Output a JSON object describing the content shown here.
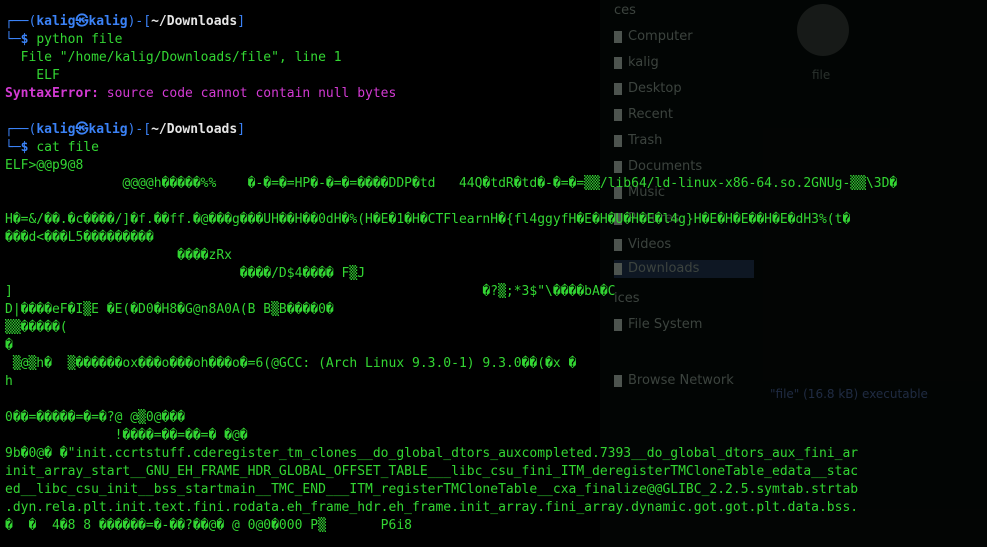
{
  "background_window": {
    "section_places": "ces",
    "sidebar": [
      {
        "label": "Computer"
      },
      {
        "label": "kalig"
      },
      {
        "label": "Desktop"
      },
      {
        "label": "Recent"
      },
      {
        "label": "Trash"
      },
      {
        "label": "Documents"
      },
      {
        "label": "Music"
      },
      {
        "label": "Pictures"
      },
      {
        "label": "Videos"
      },
      {
        "label": "Downloads"
      }
    ],
    "section_devices": "ices",
    "devices": [
      {
        "label": "File System"
      }
    ],
    "section_network": "",
    "network": [
      {
        "label": "Browse Network"
      }
    ],
    "file_icon_label": "file",
    "status_text": "\"file\" (16.8 kB) executable"
  },
  "terminal": {
    "prompt1": {
      "user": "kalig",
      "host": "kalig",
      "path": "~/Downloads",
      "command": "python file"
    },
    "python_error": {
      "file_line": "  File \"/home/kalig/Downloads/file\", line 1",
      "elf_line": "    ELF",
      "error_type": "SyntaxError:",
      "error_msg": " source code cannot contain null bytes"
    },
    "prompt2": {
      "user": "kalig",
      "host": "kalig",
      "path": "~/Downloads",
      "command": "cat file"
    },
    "output_lines": [
      "ELF>@@p9@8",
      "               @@@@h�����%%    �-�=�=HP�-�=�=����DDP�td   44Q�tdR�td�-�=�=▒▒/lib64/ld-linux-x86-64.so.2GNUg-▒▒\\3D�",
      "",
      "H�=&/��.�c����/]�f.��ff.�@���g���UH��H��0dH�%(H�E�1�H�CTFlearnH�{fl4ggyfH�E�H�U�H�E�l4g}H�E�H�E��H�E�dH3%(t�",
      "���d<���L5���������",
      "                      ����zRx",
      "                              ����/D$4���� F▒J",
      "]                                                            �?▒;*3$\"\\����bA�C",
      "D|����eF�I▒E �E(�D0�H8�G@n8A0A(B B▒B����0�",
      "▒▒�����(",
      "�",
      " ▒@▒h�  ▒������ox���o���oh���o�=6(@GCC: (Arch Linux 9.3.0-1) 9.3.0��(�x �",
      "h",
      "",
      "0��=�����=�=�?@ @▒0@���",
      "              !����=��=��=� �@�",
      "9b�0@� �\"init.ccrtstuff.cderegister_tm_clones__do_global_dtors_auxcompleted.7393__do_global_dtors_aux_fini_ar",
      "init_array_start__GNU_EH_FRAME_HDR_GLOBAL_OFFSET_TABLE___libc_csu_fini_ITM_deregisterTMCloneTable_edata__stac",
      "ed__libc_csu_init__bss_startmain__TMC_END___ITM_registerTMCloneTable__cxa_finalize@@GLIBC_2.2.5.symtab.strtab",
      ".dyn.rela.plt.init.text.fini.rodata.eh_frame_hdr.eh_frame.init_array.fini_array.dynamic.got.got.plt.data.bss.",
      "�  �  4�8 8 ������=�-��?��@� @ 0@0�000 P▒       P6i8"
    ]
  },
  "colors": {
    "prompt_frame": "#3b82f6",
    "user_host": "#3b82f6",
    "path": "#e5e5e5",
    "output": "#33d633",
    "error": "#ff5555",
    "string": "#d33ad3"
  }
}
